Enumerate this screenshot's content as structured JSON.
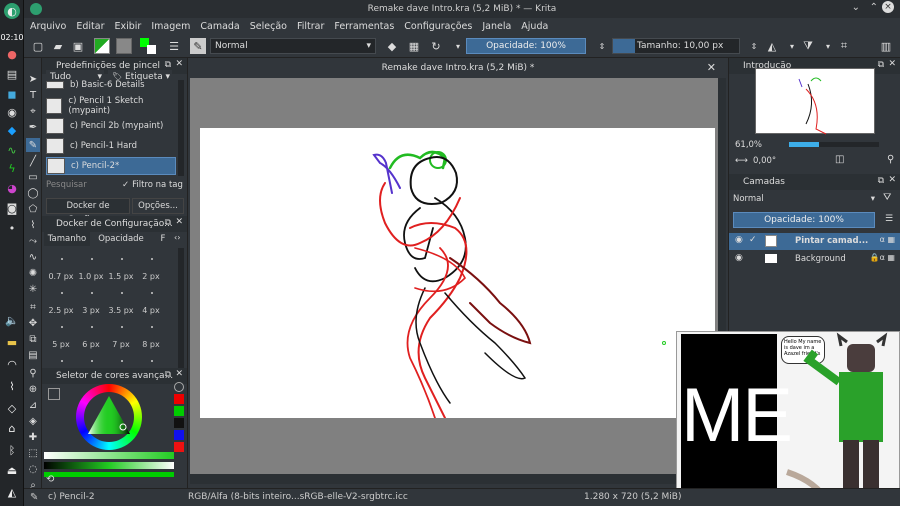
{
  "window": {
    "title": "Remake dave Intro.kra (5,2 MiB) * — Krita"
  },
  "taskbar": {
    "clock": "02:10"
  },
  "menu": [
    "Arquivo",
    "Editar",
    "Exibir",
    "Imagem",
    "Camada",
    "Seleção",
    "Filtrar",
    "Ferramentas",
    "Configurações",
    "Janela",
    "Ajuda"
  ],
  "toolbar": {
    "blend_mode": "Normal",
    "opacity": "Opacidade: 100%",
    "size": "Tamanho: 10,00 px"
  },
  "brush_presets": {
    "title": "Predefinições de pincel",
    "filter": "Tudo",
    "tag": "Etiqueta",
    "items": [
      "b) Basic-6 Details",
      "c) Pencil 1 Sketch (mypaint)",
      "c) Pencil 2b (mypaint)",
      "c) Pencil-1 Hard",
      "c) Pencil-2*"
    ],
    "search_placeholder": "Pesquisar",
    "tag_filter": "Filtro na tag"
  },
  "tool_options": {
    "tab1": "Docker de Configu...",
    "tab2": "Opções...",
    "title": "Docker de Configuração...",
    "tabs": [
      "Tamanho",
      "Opacidade",
      "F"
    ],
    "sizes": [
      "0.7 px",
      "1.0 px",
      "1.5 px",
      "2 px",
      "2.5 px",
      "3 px",
      "3.5 px",
      "4 px",
      "5 px",
      "6 px",
      "7 px",
      "8 px"
    ]
  },
  "color_selector": {
    "title": "Seletor de cores avança..."
  },
  "document": {
    "tab_title": "Remake dave Intro.kra (5,2 MiB) *"
  },
  "overview": {
    "title": "Introdução",
    "zoom": "61,0%",
    "rotation": "0,00°"
  },
  "layers": {
    "title": "Camadas",
    "blend": "Normal",
    "opacity": "Opacidade: 100%",
    "items": [
      "Pintar camad...",
      "Background"
    ]
  },
  "meme": {
    "text": "ME",
    "speech": "Hello My name is dave im a Azazel friend's"
  },
  "statusbar": {
    "brush": "c) Pencil-2",
    "colorspace": "RGB/Alfa (8-bits inteiro...sRGB-elle-V2-srgbtrc.icc",
    "dimensions": "1.280 x 720 (5,2 MiB)"
  },
  "colors": {
    "accent": "#3daee9",
    "selection": "#3d6a96",
    "sketch_red": "#e02020",
    "sketch_black": "#111111",
    "sketch_green": "#22bb22",
    "sketch_blue": "#5533cc"
  }
}
